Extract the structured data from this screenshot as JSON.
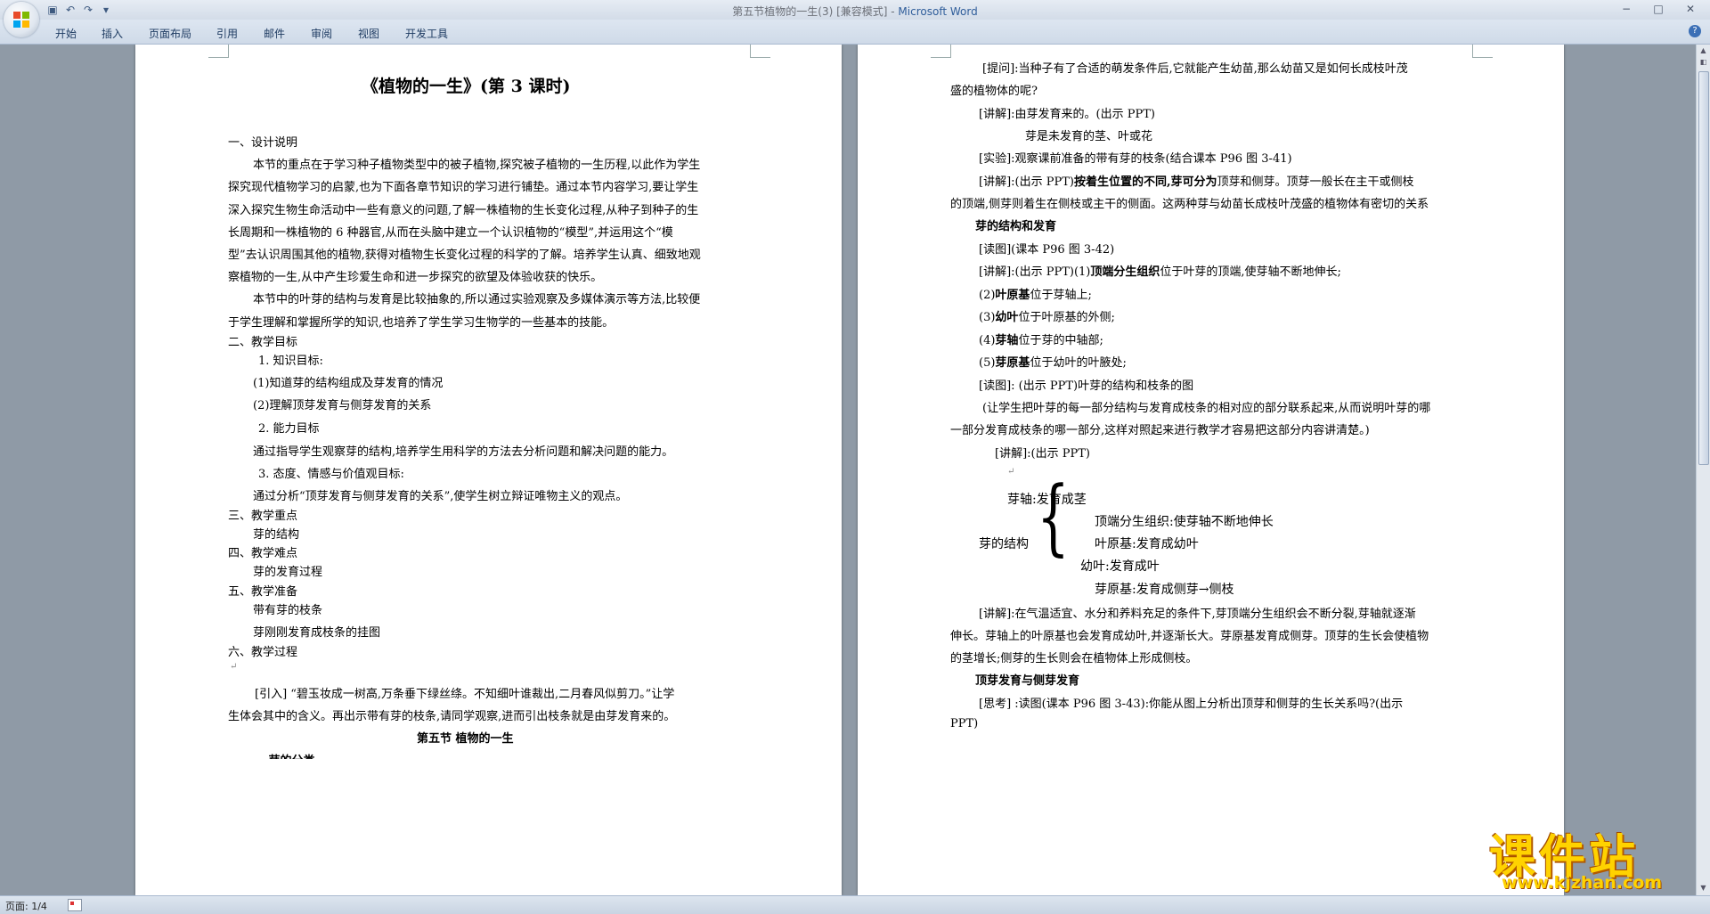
{
  "window": {
    "title": "第五节植物的一生(3) [兼容模式] - ",
    "app_name": "Microsoft Word",
    "minimize": "−",
    "maximize": "□",
    "close": "✕"
  },
  "quick_access": [
    "save-icon",
    "undo-icon",
    "redo-icon",
    "customize-icon"
  ],
  "ribbon_tabs": [
    "开始",
    "插入",
    "页面布局",
    "引用",
    "邮件",
    "审阅",
    "视图",
    "开发工具"
  ],
  "help": "?",
  "left_page": {
    "title": "《植物的一生》(第 3 课时)",
    "lines": [
      "一、设计说明",
      "本节的重点在于学习种子植物类型中的被子植物,探究被子植物的一生历程,以此作为学生",
      "探究现代植物学习的启蒙,也为下面各章节知识的学习进行铺垫。通过本节内容学习,要让学生",
      "深入探究生物生命活动中一些有意义的问题,了解一株植物的生长变化过程,从种子到种子的生",
      "长周期和一株植物的 6 种器官,从而在头脑中建立一个认识植物的“模型”,并运用这个“模",
      "型”去认识周围其他的植物,获得对植物生长变化过程的科学的了解。培养学生认真、细致地观",
      "察植物的一生,从中产生珍爱生命和进一步探究的欲望及体验收获的快乐。",
      "本节中的叶芽的结构与发育是比较抽象的,所以通过实验观察及多媒体演示等方法,比较便",
      "于学生理解和掌握所学的知识,也培养了学生学习生物学的一些基本的技能。",
      "二、教学目标",
      "1. 知识目标:",
      "(1)知道芽的结构组成及芽发育的情况",
      "(2)理解顶芽发育与侧芽发育的关系",
      "2. 能力目标",
      "通过指导学生观察芽的结构,培养学生用科学的方法去分析问题和解决问题的能力。",
      "3. 态度、情感与价值观目标:",
      "通过分析“顶芽发育与侧芽发育的关系”,使学生树立辩证唯物主义的观点。",
      "三、教学重点",
      "芽的结构",
      "四、教学难点",
      "芽的发育过程",
      "五、教学准备",
      "带有芽的枝条",
      "芽刚刚发育成枝条的挂图",
      "六、教学过程",
      "[引入] “碧玉妆成一树高,万条垂下绿丝绦。不知细叶谁裁出,二月春风似剪刀。”让学",
      "生体会其中的含义。再出示带有芽的枝条,请同学观察,进而引出枝条就是由芽发育来的。",
      "第五节   植物的一生",
      "一 芽的分类"
    ]
  },
  "right_page": {
    "lines": [
      "[提问]:当种子有了合适的萌发条件后,它就能产生幼苗,那么幼苗又是如何长成枝叶茂",
      "盛的植物体的呢?",
      "[讲解]:由芽发育来的。(出示 PPT)",
      "芽是未发育的茎、叶或花",
      "[实验]:观察课前准备的带有芽的枝条(结合课本 P96 图 3-41)",
      "[讲解]:(出示 PPT)",
      "按着生位置的不同,芽可分为",
      "顶芽和侧芽。顶芽一般长在主干或侧枝",
      "的顶端,侧芽则着生在侧枝或主干的侧面。这两种芽与幼苗长成枝叶茂盛的植物体有密切的关系",
      "芽的结构和发育",
      "[读图](课本 P96 图 3-42)",
      "[讲解]:(出示 PPT)(1)",
      "顶端分生组织",
      "位于叶芽的顶端,使芽轴不断地伸长;",
      "(2)",
      "叶原基",
      "位于芽轴上;",
      "(3)",
      "幼叶",
      "位于叶原基的外侧;",
      "(4)",
      "芽轴",
      "位于芽的中轴部;",
      "(5)",
      "芽原基",
      "位于幼叶的叶腋处;",
      "[读图]: (出示 PPT)叶芽的结构和枝条的图",
      "(让学生把叶芽的每一部分结构与发育成枝条的相对应的部分联系起来,从而说明叶芽的哪",
      "一部分发育成枝条的哪一部分,这样对照起来进行教学才容易把这部分内容讲清楚。)",
      "[讲解]:(出示 PPT)",
      "芽的结构",
      "芽轴:发育成茎",
      "顶端分生组织:使芽轴不断地伸长",
      "叶原基:发育成幼叶",
      "幼叶:发育成叶",
      "芽原基:发育成侧芽→侧枝",
      "[讲解]:在气温适宜、水分和养料充足的条件下,芽顶端分生组织会不断分裂,芽轴就逐渐",
      "伸长。芽轴上的叶原基也会发育成幼叶,并逐渐长大。芽原基发育成侧芽。顶芽的生长会使植物",
      "的茎增长;侧芽的生长则会在植物体上形成侧枝。",
      "顶芽发育与侧芽发育",
      "[思考] :读图(课本 P96 图 3-43):你能从图上分析出顶芽和侧芽的生长关系吗?(出示",
      "PPT)"
    ]
  },
  "paragraph_mark": "↵",
  "status": {
    "page": "页面: 1/4"
  },
  "watermark": {
    "text": "课件站",
    "url": "www.kjzhan.com"
  }
}
